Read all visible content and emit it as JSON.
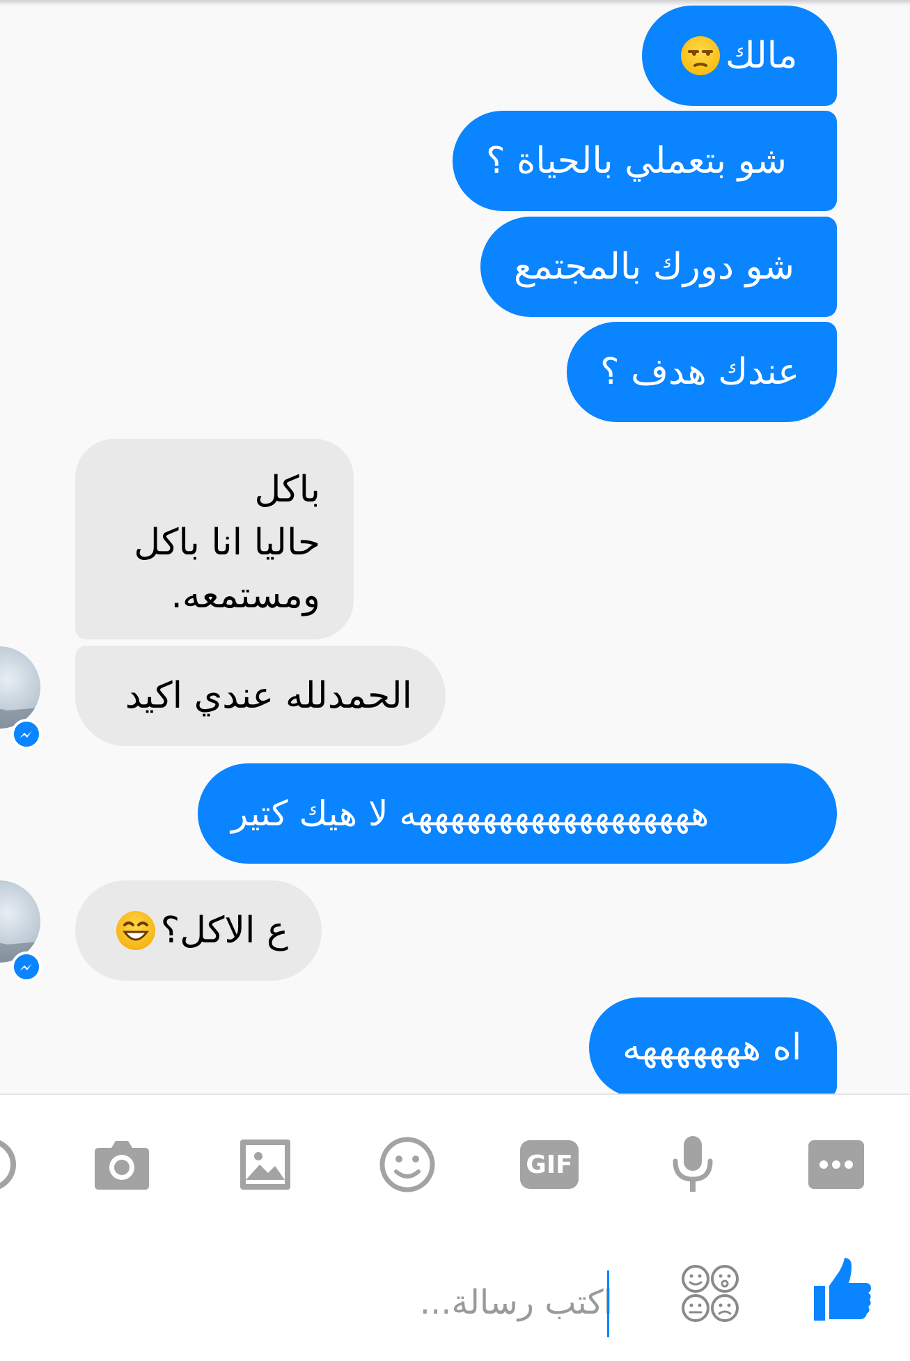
{
  "colors": {
    "outgoing_bubble": "#0a84ff",
    "incoming_bubble": "#e9e9e9",
    "icon_gray": "#a3a3a3",
    "accent": "#0a84ff"
  },
  "messages": [
    {
      "direction": "outgoing",
      "text": "مالك",
      "emoji": "unamused-face-icon"
    },
    {
      "direction": "outgoing",
      "text": "شو بتعملي بالحياة ؟"
    },
    {
      "direction": "outgoing",
      "text": "شو دورك بالمجتمع"
    },
    {
      "direction": "outgoing",
      "text": "عندك هدف ؟"
    },
    {
      "direction": "incoming",
      "text": "باكل\nحاليا انا باكل\nومستمعه."
    },
    {
      "direction": "incoming",
      "text": "الحمدلله عندي اكيد"
    },
    {
      "direction": "outgoing",
      "text": "ههههههههههههههههههه لا هيك كتير"
    },
    {
      "direction": "incoming",
      "text": "ع الاكل؟",
      "emoji": "grinning-squinting-face-icon"
    },
    {
      "direction": "outgoing",
      "text": "اه هههههههه"
    }
  ],
  "toolbar": {
    "icons": [
      "camera-icon",
      "image-icon",
      "emoji-icon",
      "gif-icon",
      "microphone-icon",
      "more-icon"
    ],
    "gif_label": "GIF"
  },
  "composer": {
    "placeholder": "اكتب رسالة...",
    "stickers_icon": "stickers-icon",
    "like_icon": "thumbs-up-icon"
  }
}
